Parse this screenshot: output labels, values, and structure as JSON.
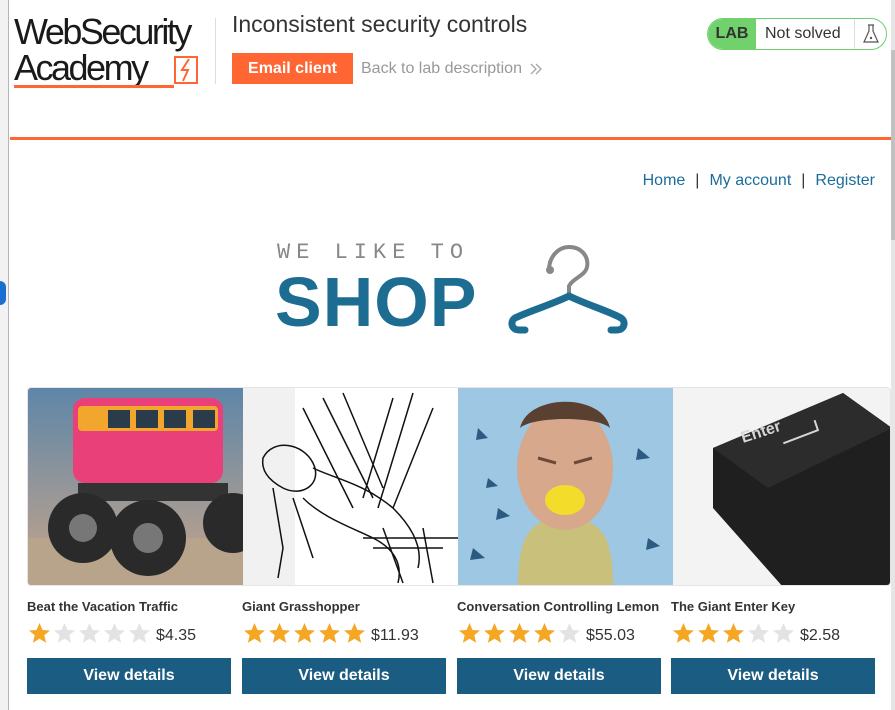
{
  "lab": {
    "title": "Inconsistent security controls",
    "email_client_label": "Email client",
    "back_link_label": "Back to lab description",
    "badge": "LAB",
    "status": "Not solved"
  },
  "logo": {
    "line1": "WebSecurity",
    "line2": "Academy"
  },
  "nav": {
    "home": "Home",
    "my_account": "My account",
    "register": "Register",
    "separator": "|"
  },
  "banner": {
    "small_text": "WE LIKE TO",
    "big_text": "SHOP"
  },
  "products": [
    {
      "name": "Beat the Vacation Traffic",
      "rating": 1,
      "price": "$4.35",
      "button": "View details"
    },
    {
      "name": "Giant Grasshopper",
      "rating": 5,
      "price": "$11.93",
      "button": "View details"
    },
    {
      "name": "Conversation Controlling Lemon",
      "rating": 4,
      "price": "$55.03",
      "button": "View details"
    },
    {
      "name": "The Giant Enter Key",
      "rating": 3,
      "price": "$2.58",
      "button": "View details"
    }
  ],
  "colors": {
    "accent": "#ff6633",
    "link": "#1a6d9c",
    "button": "#1b5c83",
    "star_on": "#f5a623",
    "star_off": "#e3e3e3",
    "lab_green": "#70d16d"
  }
}
